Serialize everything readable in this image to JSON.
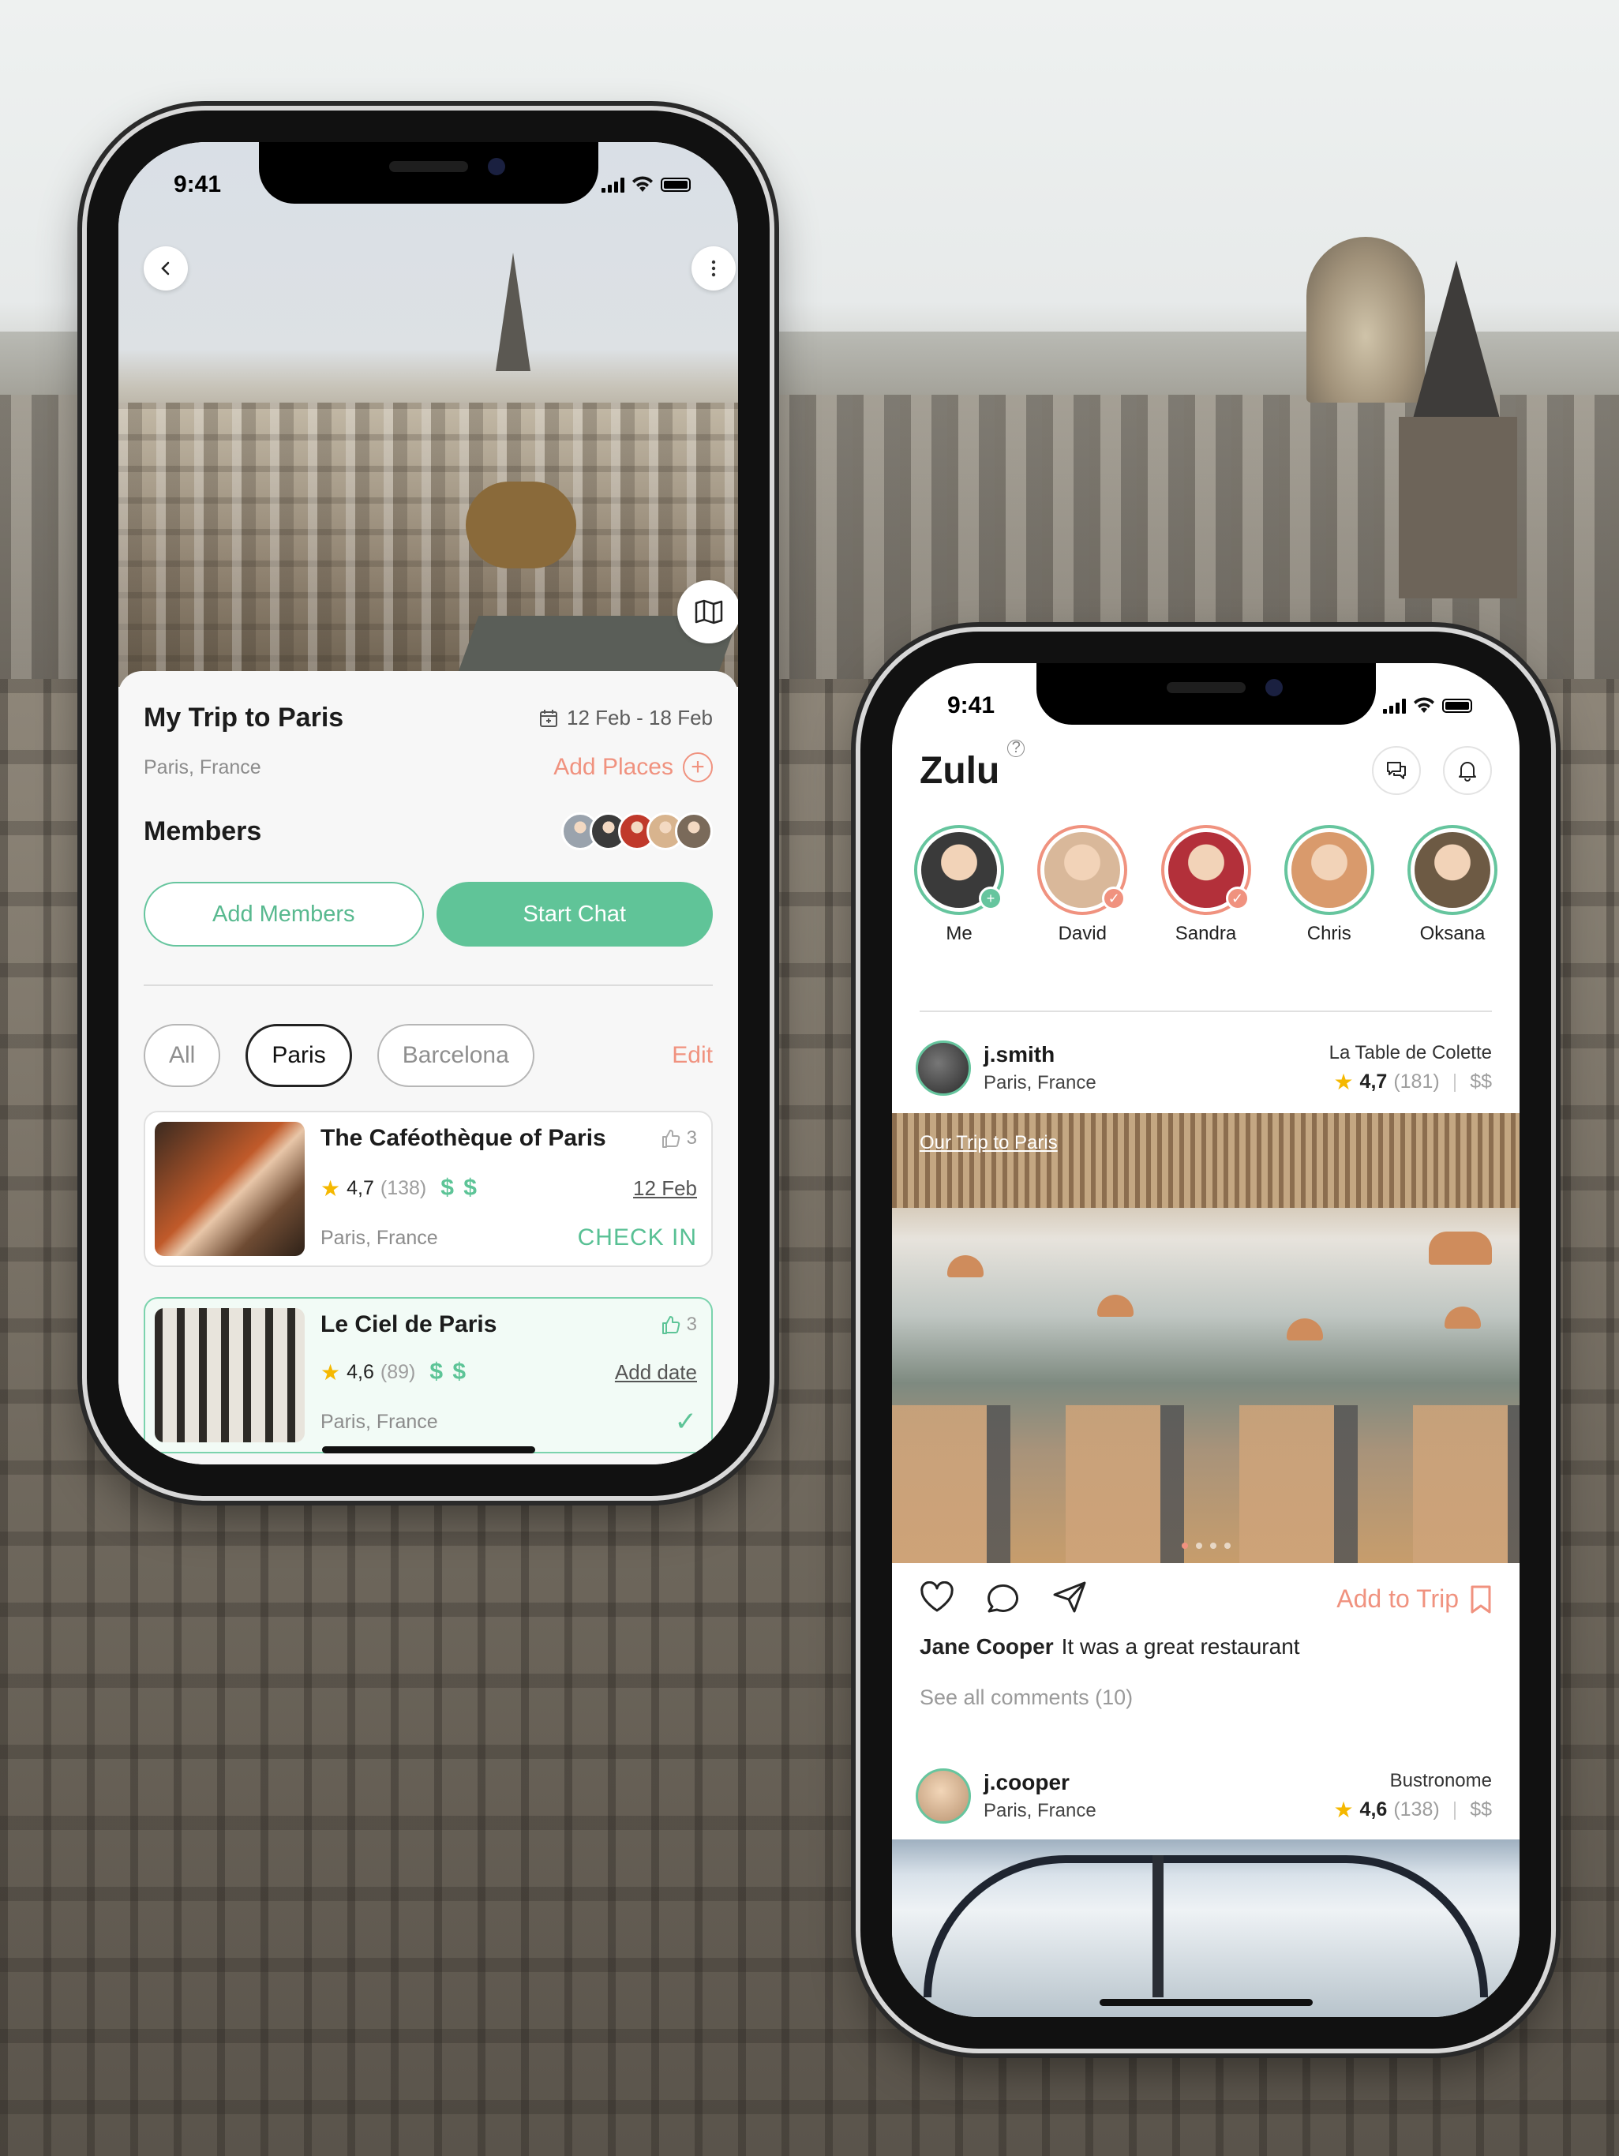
{
  "phone1": {
    "status_time": "9:41",
    "trip": {
      "title": "My Trip to Paris",
      "dates": "12 Feb - 18 Feb",
      "location": "Paris, France",
      "add_places_label": "Add Places"
    },
    "members": {
      "title": "Members",
      "avatar_colors": [
        "#9aa3ad",
        "#3b3b3b",
        "#c0392b",
        "#d8b48e",
        "#7a6a5a"
      ]
    },
    "buttons": {
      "add_members": "Add Members",
      "start_chat": "Start Chat"
    },
    "filters": {
      "items": [
        "All",
        "Paris",
        "Barcelona"
      ],
      "active": "Paris",
      "edit_label": "Edit"
    },
    "places": [
      {
        "name": "The Caféothèque of Paris",
        "likes": "3",
        "rating": "4,7",
        "reviews": "(138)",
        "price": "$ $",
        "date": "12 Feb",
        "location": "Paris, France",
        "action": "CHECK IN"
      },
      {
        "name": "Le Ciel de Paris",
        "likes": "3",
        "rating": "4,6",
        "reviews": "(89)",
        "price": "$ $",
        "date": "Add date",
        "location": "Paris, France",
        "action": "✓"
      }
    ]
  },
  "phone2": {
    "status_time": "9:41",
    "app_title": "Zulu",
    "help_mark": "?",
    "stories": [
      {
        "name": "Me",
        "ring": "#66c59e",
        "badge": "+",
        "badge_color": "#66c59e",
        "face": "#3a3a3a"
      },
      {
        "name": "David",
        "ring": "#f0927f",
        "badge": "✓",
        "badge_color": "#f0927f",
        "face": "#d9b89a"
      },
      {
        "name": "Sandra",
        "ring": "#f0927f",
        "badge": "✓",
        "badge_color": "#f0927f",
        "face": "#b3303a"
      },
      {
        "name": "Chris",
        "ring": "#66c59e",
        "badge": "",
        "badge_color": "",
        "face": "#d99a6c"
      },
      {
        "name": "Oksana",
        "ring": "#66c59e",
        "badge": "",
        "badge_color": "",
        "face": "#6d5a44"
      }
    ],
    "posts": [
      {
        "username": "j.smith",
        "location": "Paris, France",
        "venue": "La Table de Colette",
        "rating": "4,7",
        "reviews": "(181)",
        "price": "$$",
        "trip_tag": "Our Trip to Paris"
      },
      {
        "username": "j.cooper",
        "location": "Paris, France",
        "venue": "Bustronome",
        "rating": "4,6",
        "reviews": "(138)",
        "price": "$$"
      }
    ],
    "actions": {
      "add_to_trip": "Add to Trip"
    },
    "caption": {
      "author": "Jane Cooper",
      "text": "It was a great restaurant"
    },
    "comments_link": "See all comments (10)"
  }
}
